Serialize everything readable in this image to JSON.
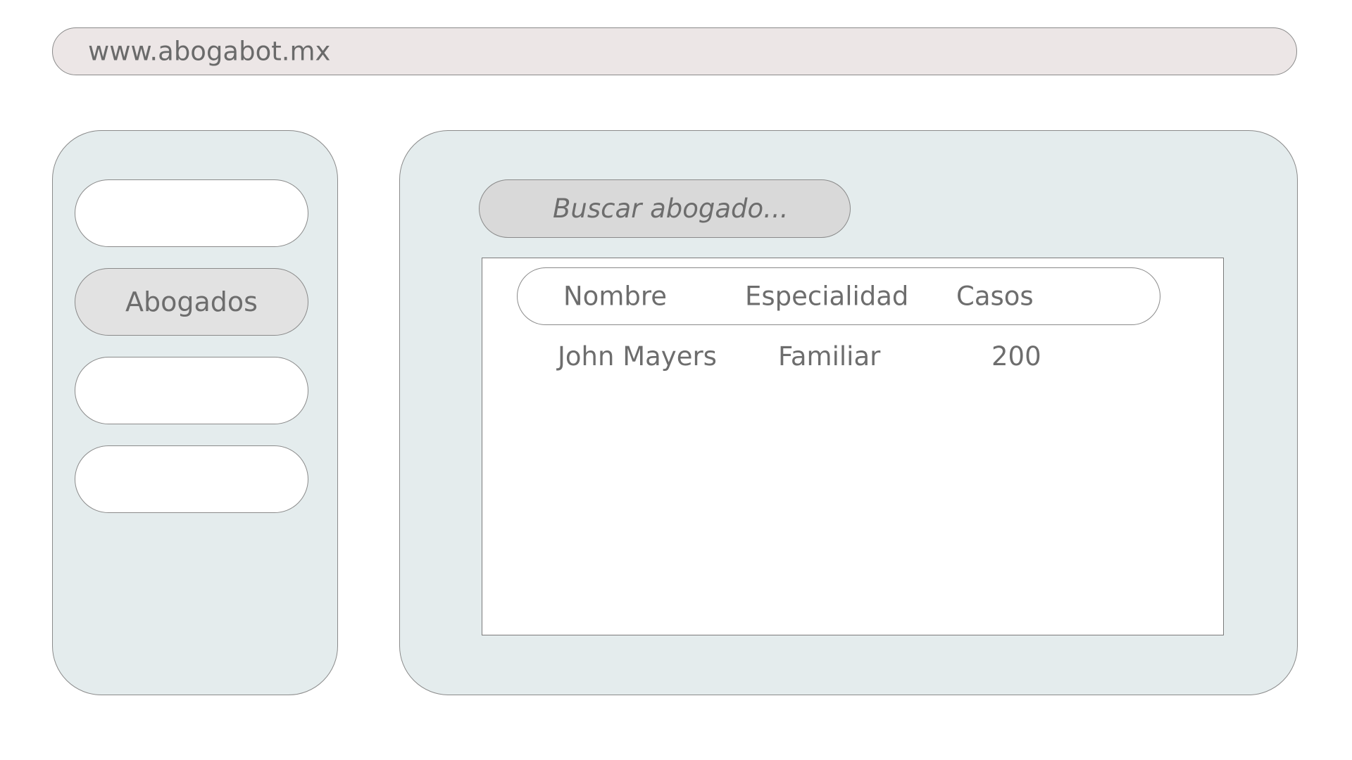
{
  "browser": {
    "url": "www.abogabot.mx"
  },
  "sidebar": {
    "items": [
      {
        "label": ""
      },
      {
        "label": "Abogados",
        "active": true
      },
      {
        "label": ""
      },
      {
        "label": ""
      }
    ]
  },
  "search": {
    "placeholder": "Buscar abogado..."
  },
  "table": {
    "headers": [
      "Nombre",
      "Especialidad",
      "Casos"
    ],
    "rows": [
      [
        "John Mayers",
        "Familiar",
        "200"
      ]
    ]
  },
  "colors": {
    "panel_bg": "#e4eced",
    "url_bar_bg": "#ece6e6",
    "active_item_bg": "#e2e2e2",
    "search_bg": "#d9d9d9",
    "text": "#6d6d6d"
  }
}
